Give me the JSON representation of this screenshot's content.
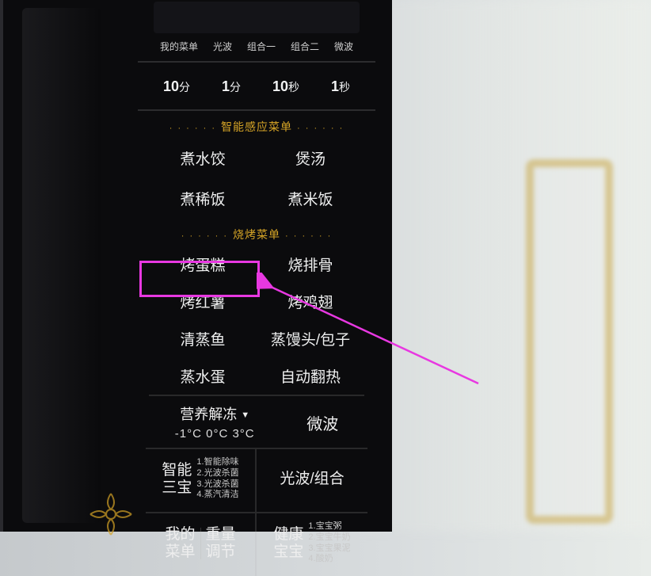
{
  "modeRow": {
    "m1": "我的菜单",
    "m2": "光波",
    "m3": "组合一",
    "m4": "组合二",
    "m5": "微波"
  },
  "time": {
    "t1": "10",
    "u1": "分",
    "t2": "1",
    "u2": "分",
    "t3": "10",
    "u3": "秒",
    "t4": "1",
    "u4": "秒"
  },
  "section": {
    "smart": "智能感应菜单",
    "grill": "烧烤菜单"
  },
  "smartMenu": {
    "a1": "煮水饺",
    "a2": "煲汤",
    "a3": "煮稀饭",
    "a4": "煮米饭"
  },
  "grillMenu": {
    "b1": "烤蛋糕",
    "b2": "烧排骨",
    "b3": "烤红薯",
    "b4": "烤鸡翅",
    "b5": "清蒸鱼",
    "b6": "蒸馒头/包子",
    "b7": "蒸水蛋",
    "b8": "自动翻热"
  },
  "thaw": {
    "title": "营养解冻",
    "caret": "▼",
    "temps": "-1°C  0°C  3°C",
    "right": "微波"
  },
  "bottom1": {
    "leftBig1": "智能",
    "leftBig2": "三宝",
    "leftList": "1.智能除味\n2.光波杀菌\n3.光波杀菌\n4.蒸汽清洁",
    "right": "光波/组合"
  },
  "bottom2": {
    "leftA1": "我的",
    "leftA2": "菜单",
    "leftB1": "重量",
    "leftB2": "调节",
    "rightBig1": "健康",
    "rightBig2": "宝宝",
    "rightList": "1.宝宝粥\n2.宝宝牛奶\n3.宝宝果泥\n4.酸奶"
  },
  "highlighted_item": "烤红薯",
  "colors": {
    "accent": "#d4a326",
    "highlight": "#e838e1"
  }
}
